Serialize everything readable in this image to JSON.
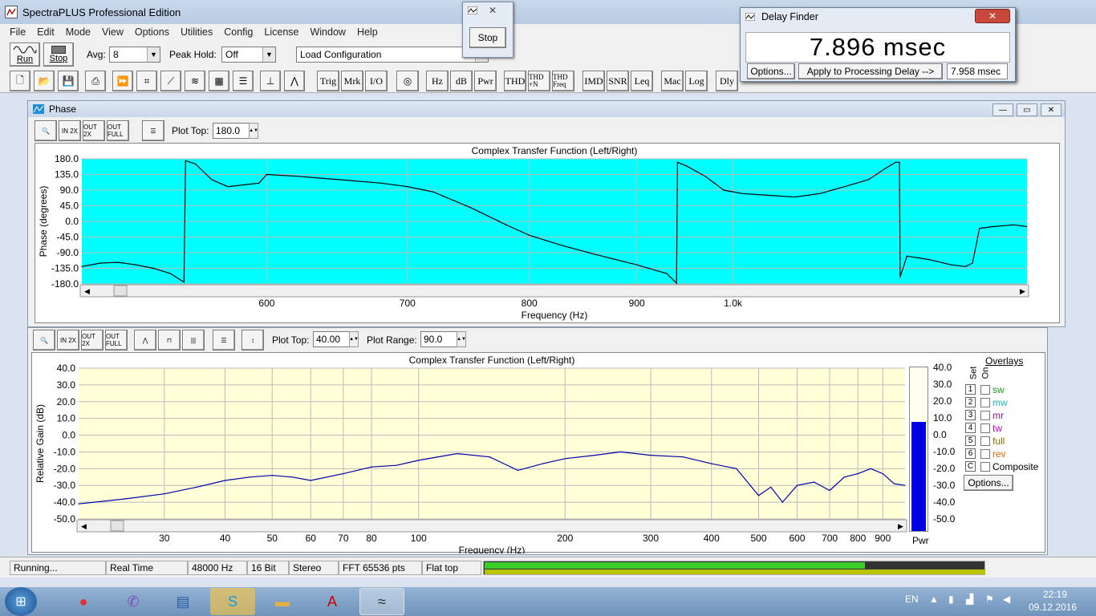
{
  "app": {
    "title": "SpectraPLUS Professional Edition",
    "menu": [
      "File",
      "Edit",
      "Mode",
      "View",
      "Options",
      "Utilities",
      "Config",
      "License",
      "Window",
      "Help"
    ]
  },
  "toolbar": {
    "run_label": "Run",
    "stop_label": "Stop",
    "avg_label": "Avg:",
    "avg_value": "8",
    "peakhold_label": "Peak Hold:",
    "peakhold_value": "Off",
    "load_config": "Load Configuration",
    "buttons": [
      "Trig",
      "Mrk",
      "I/O",
      "Hz",
      "dB",
      "Pwr",
      "THD",
      "THD +N",
      "THD Freq",
      "IMD",
      "SNR",
      "Leq",
      "Mac",
      "Log",
      "Dly"
    ]
  },
  "stop_popup": {
    "button": "Stop"
  },
  "delay_finder": {
    "title": "Delay Finder",
    "value": "7.896 msec",
    "options_button": "Options...",
    "apply_button": "Apply to Processing Delay -->",
    "delay_field": "7.958 msec"
  },
  "phase_window": {
    "title": "Phase",
    "plot_top_label": "Plot Top:",
    "plot_top_value": "180.0"
  },
  "gain_window": {
    "plot_top_label": "Plot Top:",
    "plot_top_value": "40.00",
    "plot_range_label": "Plot Range:",
    "plot_range_value": "90.0",
    "overlays_title": "Overlays",
    "set_label": "Set",
    "on_label": "On",
    "overlays": [
      {
        "num": "1",
        "name": "sw",
        "color": "#1a9e1a"
      },
      {
        "num": "2",
        "name": "mw",
        "color": "#19b5b5"
      },
      {
        "num": "3",
        "name": "mr",
        "color": "#8a1a8a"
      },
      {
        "num": "4",
        "name": "tw",
        "color": "#c800c8"
      },
      {
        "num": "5",
        "name": "full",
        "color": "#8a6a00"
      },
      {
        "num": "6",
        "name": "rev",
        "color": "#e06a00"
      },
      {
        "num": "C",
        "name": "Composite",
        "color": "#000000"
      }
    ],
    "options_button": "Options...",
    "pwr_label": "Pwr",
    "pwr_ticks": [
      "40.0",
      "30.0",
      "20.0",
      "10.0",
      "0.0",
      "-10.0",
      "-20.0",
      "-30.0",
      "-40.0",
      "-50.0"
    ],
    "pwr_level_db": 10
  },
  "chart_data": [
    {
      "type": "line",
      "title": "Complex Transfer Function (Left/Right)",
      "xlabel": "Frequency (Hz)",
      "ylabel": "Phase (degrees)",
      "x_scale": "log",
      "xlim": [
        490,
        1380
      ],
      "ylim": [
        -180,
        180
      ],
      "yticks": [
        "180.0",
        "135.0",
        "90.0",
        "45.0",
        "0.0",
        "-45.0",
        "-90.0",
        "-135.0",
        "-180.0"
      ],
      "xticks": [
        {
          "v": 600,
          "t": "600"
        },
        {
          "v": 700,
          "t": "700"
        },
        {
          "v": 800,
          "t": "800"
        },
        {
          "v": 900,
          "t": "900"
        },
        {
          "v": 1000,
          "t": "1.0k"
        }
      ],
      "background": "#00ffff",
      "series": [
        {
          "color": "#000000",
          "x": [
            490,
            500,
            510,
            520,
            530,
            540,
            548,
            549,
            555,
            565,
            575,
            585,
            595,
            600,
            620,
            650,
            680,
            700,
            720,
            750,
            780,
            800,
            830,
            860,
            900,
            930,
            940,
            941,
            950,
            970,
            990,
            1010,
            1040,
            1070,
            1100,
            1130,
            1160,
            1180,
            1195,
            1200,
            1201,
            1210,
            1240,
            1270,
            1290,
            1300,
            1310,
            1330,
            1360,
            1380
          ],
          "y": [
            -130,
            -120,
            -118,
            -125,
            -135,
            -150,
            -175,
            175,
            165,
            120,
            100,
            105,
            110,
            135,
            130,
            120,
            110,
            100,
            85,
            40,
            -10,
            -40,
            -70,
            -95,
            -125,
            -150,
            -178,
            170,
            160,
            130,
            90,
            80,
            75,
            70,
            80,
            100,
            120,
            150,
            170,
            170,
            -160,
            -100,
            -110,
            -125,
            -130,
            -120,
            -20,
            -15,
            -10,
            -15
          ]
        }
      ]
    },
    {
      "type": "line",
      "title": "Complex Transfer Function (Left/Right)",
      "xlabel": "Frequency (Hz)",
      "ylabel": "Relative Gain (dB)",
      "x_scale": "log",
      "xlim": [
        20,
        1000
      ],
      "ylim": [
        -50,
        40
      ],
      "yticks": [
        "40.0",
        "30.0",
        "20.0",
        "10.0",
        "0.0",
        "-10.0",
        "-20.0",
        "-30.0",
        "-40.0",
        "-50.0"
      ],
      "xticks": [
        {
          "v": 30,
          "t": "30"
        },
        {
          "v": 40,
          "t": "40"
        },
        {
          "v": 50,
          "t": "50"
        },
        {
          "v": 60,
          "t": "60"
        },
        {
          "v": 70,
          "t": "70"
        },
        {
          "v": 80,
          "t": "80"
        },
        {
          "v": 100,
          "t": "100"
        },
        {
          "v": 200,
          "t": "200"
        },
        {
          "v": 300,
          "t": "300"
        },
        {
          "v": 400,
          "t": "400"
        },
        {
          "v": 500,
          "t": "500"
        },
        {
          "v": 600,
          "t": "600"
        },
        {
          "v": 700,
          "t": "700"
        },
        {
          "v": 800,
          "t": "800"
        },
        {
          "v": 900,
          "t": "900"
        }
      ],
      "background": "#ffffd8",
      "series": [
        {
          "color": "#0000aa",
          "x": [
            20,
            25,
            30,
            35,
            40,
            45,
            50,
            55,
            60,
            70,
            80,
            90,
            100,
            120,
            140,
            160,
            180,
            200,
            230,
            260,
            300,
            350,
            400,
            450,
            500,
            530,
            560,
            600,
            650,
            700,
            750,
            800,
            850,
            900,
            950,
            1000
          ],
          "y": [
            -41,
            -38,
            -35,
            -31,
            -27,
            -25,
            -24,
            -25,
            -27,
            -23,
            -19,
            -18,
            -15,
            -11,
            -13,
            -21,
            -17,
            -14,
            -12,
            -10,
            -12,
            -13,
            -17,
            -20,
            -36,
            -31,
            -40,
            -30,
            -28,
            -33,
            -25,
            -23,
            -20,
            -23,
            -29,
            -30
          ]
        }
      ]
    }
  ],
  "status": {
    "state": "Running...",
    "mode": "Real Time",
    "rate": "48000 Hz",
    "bits": "16 Bit",
    "channels": "Stereo",
    "fft": "FFT 65536 pts",
    "window": "Flat top"
  },
  "taskbar": {
    "lang": "EN",
    "time": "22:19",
    "date": "09.12.2016"
  }
}
